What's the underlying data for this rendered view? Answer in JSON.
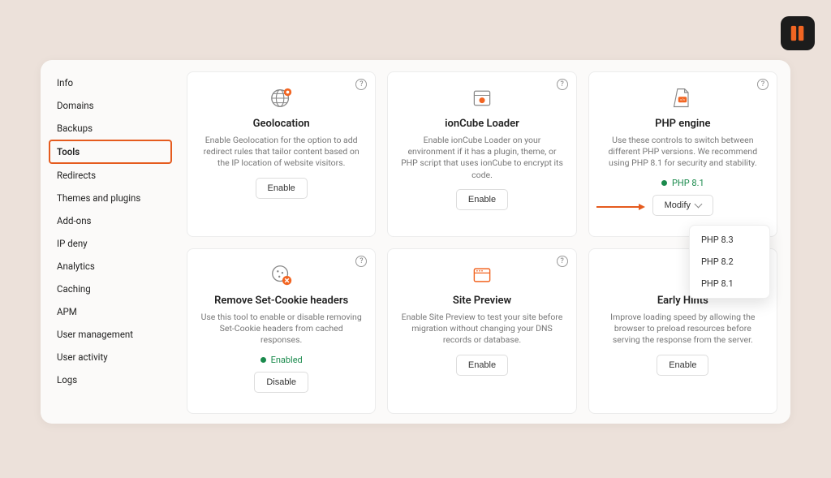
{
  "brand": {
    "logo_name": "brand-logo"
  },
  "sidebar": {
    "active_index": 3,
    "items": [
      "Info",
      "Domains",
      "Backups",
      "Tools",
      "Redirects",
      "Themes and plugins",
      "Add-ons",
      "IP deny",
      "Analytics",
      "Caching",
      "APM",
      "User management",
      "User activity",
      "Logs"
    ]
  },
  "cards": [
    {
      "key": "geolocation",
      "icon": "globe-pin-icon",
      "title": "Geolocation",
      "desc": "Enable Geolocation for the option to add redirect rules that tailor content based on the IP location of website visitors.",
      "button": "Enable"
    },
    {
      "key": "ioncube",
      "icon": "browser-gear-icon",
      "title": "ionCube Loader",
      "desc": "Enable ionCube Loader on your environment if it has a plugin, theme, or PHP script that uses ionCube to encrypt its code.",
      "button": "Enable"
    },
    {
      "key": "php-engine",
      "icon": "php-file-icon",
      "title": "PHP engine",
      "desc": "Use these controls to switch between different PHP versions. We recommend using PHP 8.1 for security and stability.",
      "status": "PHP 8.1",
      "button": "Modify",
      "has_chevron": true,
      "dropdown": [
        "PHP 8.3",
        "PHP 8.2",
        "PHP 8.1"
      ]
    },
    {
      "key": "remove-set-cookie",
      "icon": "cookie-x-icon",
      "title": "Remove Set-Cookie headers",
      "desc": "Use this tool to enable or disable removing Set-Cookie headers from cached responses.",
      "status": "Enabled",
      "button": "Disable"
    },
    {
      "key": "site-preview",
      "icon": "browser-window-icon",
      "title": "Site Preview",
      "desc": "Enable Site Preview to test your site before migration without changing your DNS records or database.",
      "button": "Enable"
    },
    {
      "key": "early-hints",
      "icon": "",
      "title": "Early Hints",
      "desc": "Improve loading speed by allowing the browser to preload resources before serving the response from the server.",
      "button": "Enable"
    }
  ]
}
